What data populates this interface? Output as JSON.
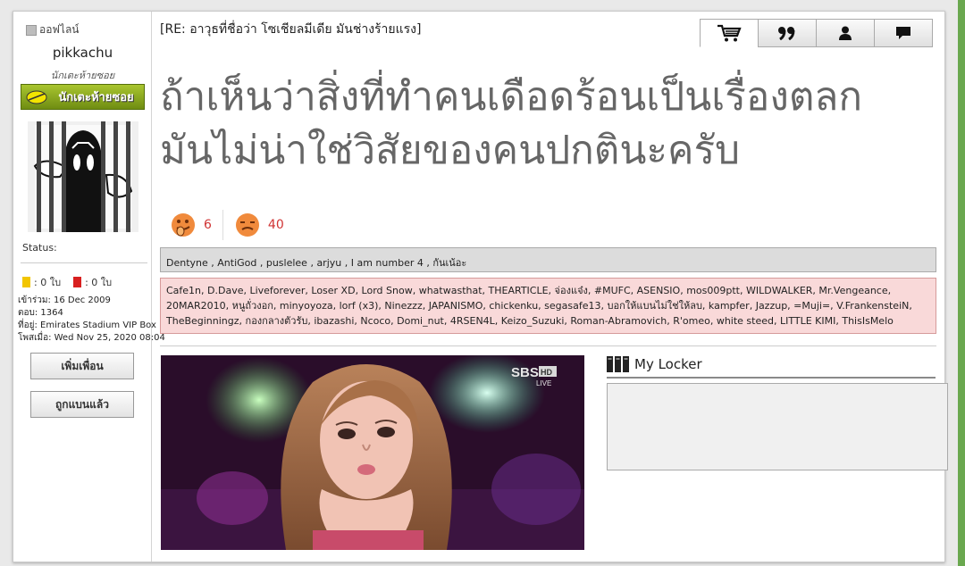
{
  "profile": {
    "online_status": "ออฟไลน์",
    "username": "pikkachu",
    "user_title": "นักเตะห้ายซอย",
    "rank_label": "นักเตะห้ายซอย",
    "status_label": "Status:",
    "yellow_cards": ": 0 ใบ",
    "red_cards": ": 0 ใบ",
    "joined": "เข้าร่วม: 16 Dec 2009",
    "posts": "ตอบ: 1364",
    "location": "ที่อยู่: Emirates Stadium VIP Box",
    "last_post": "โพสเมื่อ: Wed Nov 25, 2020 08:04",
    "add_friend_button": "เพิ่มเพื่อน",
    "banned_button": "ถูกแบนแล้ว"
  },
  "post": {
    "title": "[RE: อาวุธที่ชื่อว่า โซเชียลมีเดีย มันช่างร้ายแรง]",
    "message_lines": [
      "ถ้าเห็นว่าสิ่งที่ทำคนเดือดร้อนเป็นเรื่องตลก",
      "มันไม่น่าใช่วิสัยของคนปกตินะครับ"
    ],
    "likes_count": "6",
    "dislikes_count": "40",
    "likers": "Dentyne , AntiGod , puslelee , arjyu , I am number 4 , กันเน้อะ",
    "haters_lines": [
      "Cafe1n, D.Dave, Liveforever, Loser XD, Lord Snow, whatwasthat, THEARTICLE, จ่องแจ๋ง, #MUFC, ASENSIO, mos009ptt, WILDWALKER, Mr.Vengeance,",
      "20MAR2010, หนูถั่วงอก, minyoyoza, lorf (x3), Ninezzz, JAPANISMO, chickenku, segasafe13, บอกให้แบนไม่ใช่ให้ลบ, kampfer, Jazzup, =Muji=, V.FrankensteiN,",
      "TheBeginningz, กองกลางตัวรับ, ibazashi, Ncoco, Domi_nut, 4RSEN4L, Keizo_Suzuki, Roman-Abramovich, R'omeo, white steed, LITTLE KIMI, ThisIsMelo"
    ],
    "image_watermark": "SBS",
    "image_badge": "HD",
    "image_live": "LIVE"
  },
  "toolbar": {
    "icons": [
      "cart-icon",
      "quote-icon",
      "user-icon",
      "message-icon"
    ]
  },
  "locker": {
    "title": "My Locker"
  },
  "colors": {
    "page_bg": "#e9e9e9",
    "rank_badge": "#8fae1f",
    "hater_bg": "#f9d9d9",
    "liker_bg": "#dcdcdc",
    "count_red": "#d03434"
  }
}
